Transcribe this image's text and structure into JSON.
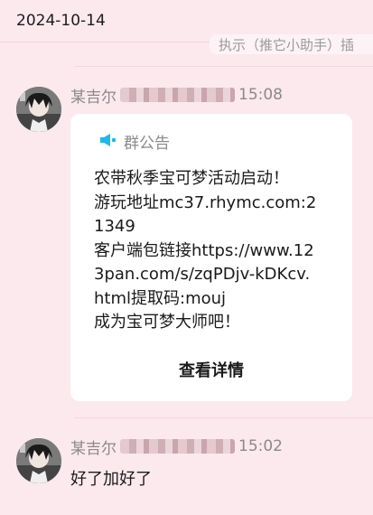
{
  "date_header": "2024-10-14",
  "prev_message_snippet": "执示（推它小助手）插",
  "messages": [
    {
      "sender": "某吉尔",
      "time": "15:08",
      "notice": {
        "icon": "megaphone-icon",
        "title": "群公告",
        "lines": [
          "农带秋季宝可梦活动启动！",
          "游玩地址mc37.rhymc.com:2",
          "1349",
          "客户端包链接https://www.12",
          "3pan.com/s/zqPDjv-kDKcv.",
          "html提取码:mouj",
          "成为宝可梦大师吧！"
        ],
        "action_label": "查看详情"
      }
    },
    {
      "sender": "某吉尔",
      "time": "15:02",
      "text": "好了加好了"
    }
  ],
  "colors": {
    "background": "#fbe9ee",
    "card": "#ffffff",
    "accent_icon": "#1fb8ea",
    "muted_text": "#8a8a8a"
  }
}
